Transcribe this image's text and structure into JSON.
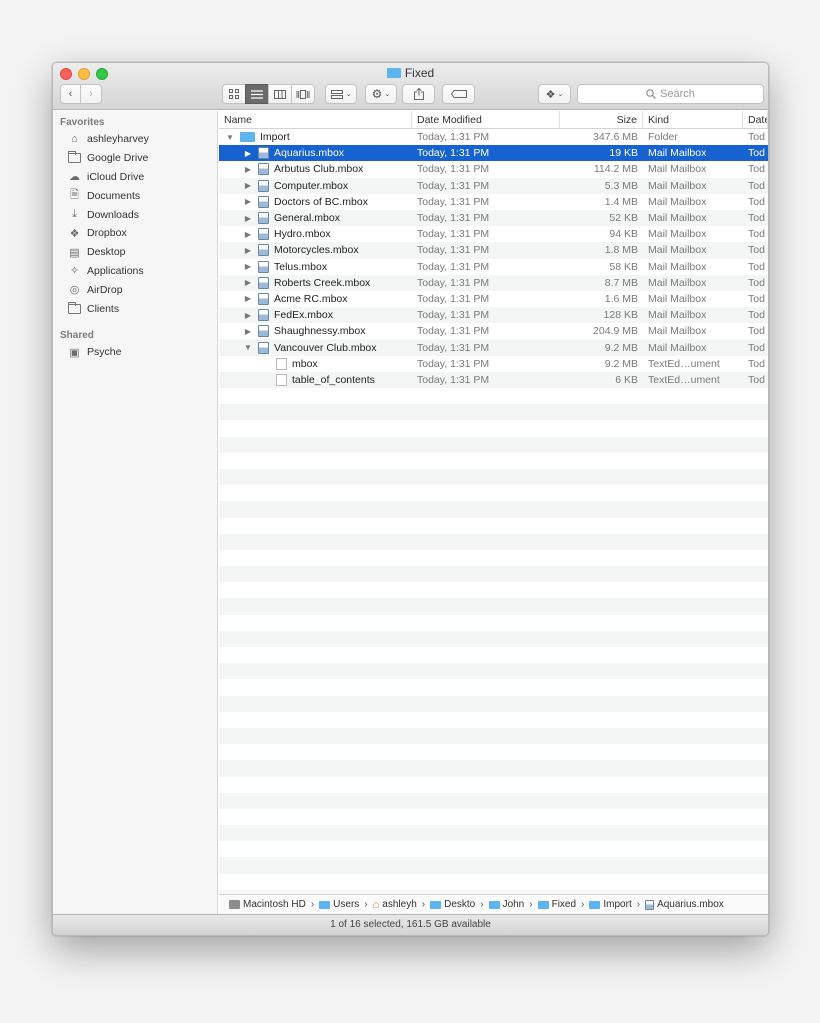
{
  "window": {
    "title": "Fixed"
  },
  "toolbar": {
    "back": "‹",
    "forward": "›",
    "search_placeholder": "Search"
  },
  "sidebar": {
    "favorites_header": "Favorites",
    "favorites": [
      {
        "label": "ashleyharvey",
        "icon": "home-icon"
      },
      {
        "label": "Google Drive",
        "icon": "folder-icon"
      },
      {
        "label": "iCloud Drive",
        "icon": "cloud-icon"
      },
      {
        "label": "Documents",
        "icon": "documents-icon"
      },
      {
        "label": "Downloads",
        "icon": "downloads-icon"
      },
      {
        "label": "Dropbox",
        "icon": "dropbox-icon"
      },
      {
        "label": "Desktop",
        "icon": "desktop-icon"
      },
      {
        "label": "Applications",
        "icon": "applications-icon"
      },
      {
        "label": "AirDrop",
        "icon": "airdrop-icon"
      },
      {
        "label": "Clients",
        "icon": "folder-icon"
      }
    ],
    "shared_header": "Shared",
    "shared": [
      {
        "label": "Psyche",
        "icon": "server-icon"
      }
    ]
  },
  "columns": {
    "name": "Name",
    "date": "Date Modified",
    "size": "Size",
    "kind": "Kind",
    "date2": "Date"
  },
  "rows": [
    {
      "name": "Import",
      "date": "Today, 1:31 PM",
      "size": "347.6 MB",
      "kind": "Folder",
      "date2": "Tod"
    },
    {
      "name": "Aquarius.mbox",
      "date": "Today, 1:31 PM",
      "size": "19 KB",
      "kind": "Mail Mailbox",
      "date2": "Tod"
    },
    {
      "name": "Arbutus Club.mbox",
      "date": "Today, 1:31 PM",
      "size": "114.2 MB",
      "kind": "Mail Mailbox",
      "date2": "Tod"
    },
    {
      "name": "Computer.mbox",
      "date": "Today, 1:31 PM",
      "size": "5.3 MB",
      "kind": "Mail Mailbox",
      "date2": "Tod"
    },
    {
      "name": "Doctors of BC.mbox",
      "date": "Today, 1:31 PM",
      "size": "1.4 MB",
      "kind": "Mail Mailbox",
      "date2": "Tod"
    },
    {
      "name": "General.mbox",
      "date": "Today, 1:31 PM",
      "size": "52 KB",
      "kind": "Mail Mailbox",
      "date2": "Tod"
    },
    {
      "name": "Hydro.mbox",
      "date": "Today, 1:31 PM",
      "size": "94 KB",
      "kind": "Mail Mailbox",
      "date2": "Tod"
    },
    {
      "name": "Motorcycles.mbox",
      "date": "Today, 1:31 PM",
      "size": "1.8 MB",
      "kind": "Mail Mailbox",
      "date2": "Tod"
    },
    {
      "name": "Telus.mbox",
      "date": "Today, 1:31 PM",
      "size": "58 KB",
      "kind": "Mail Mailbox",
      "date2": "Tod"
    },
    {
      "name": "Roberts Creek.mbox",
      "date": "Today, 1:31 PM",
      "size": "8.7 MB",
      "kind": "Mail Mailbox",
      "date2": "Tod"
    },
    {
      "name": "Acme RC.mbox",
      "date": "Today, 1:31 PM",
      "size": "1.6 MB",
      "kind": "Mail Mailbox",
      "date2": "Tod"
    },
    {
      "name": "FedEx.mbox",
      "date": "Today, 1:31 PM",
      "size": "128 KB",
      "kind": "Mail Mailbox",
      "date2": "Tod"
    },
    {
      "name": "Shaughnessy.mbox",
      "date": "Today, 1:31 PM",
      "size": "204.9 MB",
      "kind": "Mail Mailbox",
      "date2": "Tod"
    },
    {
      "name": "Vancouver Club.mbox",
      "date": "Today, 1:31 PM",
      "size": "9.2 MB",
      "kind": "Mail Mailbox",
      "date2": "Tod"
    },
    {
      "name": "mbox",
      "date": "Today, 1:31 PM",
      "size": "9.2 MB",
      "kind": "TextEd…ument",
      "date2": "Tod"
    },
    {
      "name": "table_of_contents",
      "date": "Today, 1:31 PM",
      "size": "6 KB",
      "kind": "TextEd…ument",
      "date2": "Tod"
    }
  ],
  "pathbar": [
    "Macintosh HD",
    "Users",
    "ashleyh",
    "Deskto",
    "John",
    "Fixed",
    "Import",
    "Aquarius.mbox"
  ],
  "status": "1 of 16 selected, 161.5 GB available"
}
